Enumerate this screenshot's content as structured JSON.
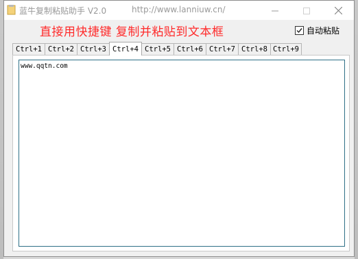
{
  "window": {
    "title": "蓝牛复制粘贴助手 V2.0",
    "url": "http://www.lanniuw.cn/",
    "controls": {
      "minimize_icon": "minimize-icon",
      "maximize_icon": "maximize-icon",
      "close_icon": "close-icon"
    }
  },
  "header": {
    "hint": "直接用快捷键 复制并粘贴到文本框",
    "hint_color": "#ff2a2a",
    "auto_paste_label": "自动粘贴",
    "auto_paste_checked": true
  },
  "tabs": [
    {
      "label": "Ctrl+1",
      "active": false
    },
    {
      "label": "Ctrl+2",
      "active": false
    },
    {
      "label": "Ctrl+3",
      "active": false
    },
    {
      "label": "Ctrl+4",
      "active": true
    },
    {
      "label": "Ctrl+5",
      "active": false
    },
    {
      "label": "Ctrl+6",
      "active": false
    },
    {
      "label": "Ctrl+7",
      "active": false
    },
    {
      "label": "Ctrl+8",
      "active": false
    },
    {
      "label": "Ctrl+9",
      "active": false
    }
  ],
  "editor": {
    "content": "www.qqtn.com",
    "border_color": "#2d6f86"
  }
}
